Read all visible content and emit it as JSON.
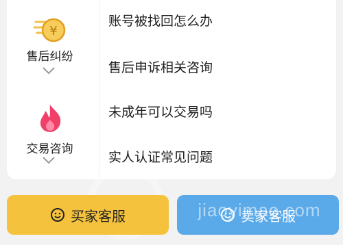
{
  "categories": [
    {
      "label": "售后纠纷",
      "icon": "yen-coin-icon",
      "color": "#e0a020"
    },
    {
      "label": "交易咨询",
      "icon": "flame-icon",
      "color": "#ee4466"
    }
  ],
  "questions": [
    "账号被找回怎么办",
    "售后申诉相关咨询",
    "未成年可以交易吗",
    "实人认证常见问题"
  ],
  "buttons": {
    "buyer_service": "买家客服",
    "seller_service": "卖家客服"
  },
  "watermark": "jiaoyimao.com",
  "colors": {
    "left_button": "#f4c23c",
    "right_button": "#5aa9e9"
  }
}
